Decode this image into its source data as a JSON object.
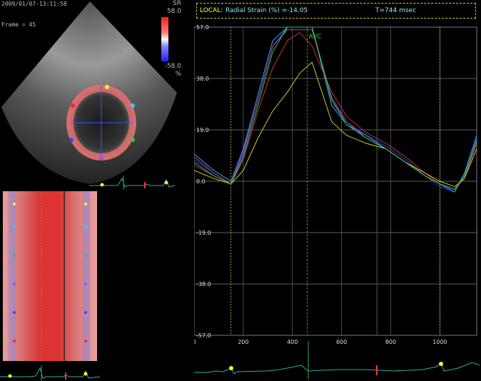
{
  "echo": {
    "timestamp": "2009/01/07-13:11:58",
    "frame_label": "Frame = 45"
  },
  "scale": {
    "title": "SR",
    "max": "58.0",
    "min": "-58.0",
    "unit": "%"
  },
  "header": {
    "local_label": "LOCAL:",
    "measure_label": "Radial Strain (%) =-14.05",
    "time_label": "T=744 msec"
  },
  "colors": {
    "background": "#000000",
    "grid": "#7a7a7a",
    "marker_yellow": "#cccc33",
    "marker_green": "#33aa33",
    "text_cyan": "#88eeee",
    "text_yellow": "#ffff44",
    "ecg": "#33aaaa"
  },
  "chart_data": {
    "type": "line",
    "ylim": [
      -57.0,
      57.0
    ],
    "xlim": [
      0,
      1150
    ],
    "y_ticks": [
      "57.0",
      "38.0",
      "19.0",
      "0.0",
      "-19.0",
      "-38.0",
      "-57.0"
    ],
    "x_ticks": [
      "0",
      "200",
      "400",
      "600",
      "800",
      "1000"
    ],
    "annotation": "AVC",
    "markers": {
      "avc_time": 460,
      "cursor_time": 744,
      "start_time": 150,
      "end_time": 1000
    },
    "series": [
      {
        "color": "#3333ff",
        "x": [
          0,
          80,
          150,
          200,
          260,
          320,
          380,
          430,
          480,
          560,
          620,
          700,
          780,
          860,
          940,
          1000,
          1060,
          1100,
          1150
        ],
        "y": [
          8,
          3,
          -1,
          10,
          30,
          50,
          57,
          57,
          57,
          30,
          22,
          17,
          13,
          8,
          2,
          -2,
          -4,
          2,
          16
        ]
      },
      {
        "color": "#33aaff",
        "x": [
          0,
          80,
          150,
          200,
          260,
          320,
          380,
          430,
          480,
          560,
          620,
          700,
          780,
          860,
          940,
          1000,
          1060,
          1100,
          1150
        ],
        "y": [
          10,
          4,
          0,
          12,
          32,
          52,
          57,
          57,
          57,
          28,
          21,
          17,
          12,
          7,
          2,
          -1,
          -4,
          3,
          17
        ]
      },
      {
        "color": "#cc3333",
        "x": [
          0,
          80,
          150,
          200,
          260,
          320,
          380,
          430,
          480,
          560,
          620,
          700,
          780,
          860,
          940,
          1000,
          1060,
          1100,
          1150
        ],
        "y": [
          6,
          2,
          -1,
          8,
          26,
          42,
          52,
          55,
          50,
          33,
          24,
          18,
          14,
          9,
          3,
          -1,
          -3,
          1,
          14
        ]
      },
      {
        "color": "#cccc33",
        "x": [
          0,
          80,
          150,
          200,
          260,
          320,
          380,
          430,
          480,
          560,
          620,
          700,
          780,
          860,
          940,
          1000,
          1060,
          1100,
          1150
        ],
        "y": [
          4,
          1,
          -1,
          4,
          16,
          26,
          33,
          40,
          44,
          22,
          17,
          14,
          12,
          7,
          3,
          0,
          -2,
          1,
          12
        ]
      },
      {
        "color": "#aa44aa",
        "x": [
          0,
          80,
          150,
          200,
          260,
          320,
          380,
          430,
          480,
          560,
          620,
          700,
          780,
          860,
          940,
          1000,
          1060,
          1100,
          1150
        ],
        "y": [
          9,
          3,
          -1,
          11,
          30,
          50,
          56,
          56,
          56,
          31,
          22,
          16,
          12,
          7,
          2,
          -1,
          -3,
          2,
          15
        ]
      },
      {
        "color": "#33cc33",
        "x": [
          0,
          80,
          150,
          200,
          260,
          320,
          380,
          430,
          480,
          560,
          620,
          700,
          780,
          860,
          940,
          1000,
          1060,
          1100,
          1150
        ],
        "y": [
          7,
          2,
          -1,
          9,
          28,
          48,
          57,
          57,
          57,
          30,
          21,
          16,
          12,
          7,
          2,
          -1,
          -3,
          2,
          15
        ]
      }
    ]
  }
}
